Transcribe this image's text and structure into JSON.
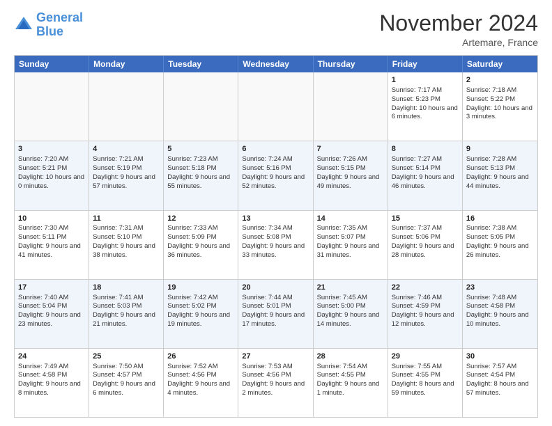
{
  "header": {
    "logo_line1": "General",
    "logo_line2": "Blue",
    "month_title": "November 2024",
    "location": "Artemare, France"
  },
  "days_of_week": [
    "Sunday",
    "Monday",
    "Tuesday",
    "Wednesday",
    "Thursday",
    "Friday",
    "Saturday"
  ],
  "weeks": [
    [
      {
        "day": "",
        "empty": true
      },
      {
        "day": "",
        "empty": true
      },
      {
        "day": "",
        "empty": true
      },
      {
        "day": "",
        "empty": true
      },
      {
        "day": "",
        "empty": true
      },
      {
        "day": "1",
        "sunrise": "Sunrise: 7:17 AM",
        "sunset": "Sunset: 5:23 PM",
        "daylight": "Daylight: 10 hours and 6 minutes."
      },
      {
        "day": "2",
        "sunrise": "Sunrise: 7:18 AM",
        "sunset": "Sunset: 5:22 PM",
        "daylight": "Daylight: 10 hours and 3 minutes."
      }
    ],
    [
      {
        "day": "3",
        "sunrise": "Sunrise: 7:20 AM",
        "sunset": "Sunset: 5:21 PM",
        "daylight": "Daylight: 10 hours and 0 minutes."
      },
      {
        "day": "4",
        "sunrise": "Sunrise: 7:21 AM",
        "sunset": "Sunset: 5:19 PM",
        "daylight": "Daylight: 9 hours and 57 minutes."
      },
      {
        "day": "5",
        "sunrise": "Sunrise: 7:23 AM",
        "sunset": "Sunset: 5:18 PM",
        "daylight": "Daylight: 9 hours and 55 minutes."
      },
      {
        "day": "6",
        "sunrise": "Sunrise: 7:24 AM",
        "sunset": "Sunset: 5:16 PM",
        "daylight": "Daylight: 9 hours and 52 minutes."
      },
      {
        "day": "7",
        "sunrise": "Sunrise: 7:26 AM",
        "sunset": "Sunset: 5:15 PM",
        "daylight": "Daylight: 9 hours and 49 minutes."
      },
      {
        "day": "8",
        "sunrise": "Sunrise: 7:27 AM",
        "sunset": "Sunset: 5:14 PM",
        "daylight": "Daylight: 9 hours and 46 minutes."
      },
      {
        "day": "9",
        "sunrise": "Sunrise: 7:28 AM",
        "sunset": "Sunset: 5:13 PM",
        "daylight": "Daylight: 9 hours and 44 minutes."
      }
    ],
    [
      {
        "day": "10",
        "sunrise": "Sunrise: 7:30 AM",
        "sunset": "Sunset: 5:11 PM",
        "daylight": "Daylight: 9 hours and 41 minutes."
      },
      {
        "day": "11",
        "sunrise": "Sunrise: 7:31 AM",
        "sunset": "Sunset: 5:10 PM",
        "daylight": "Daylight: 9 hours and 38 minutes."
      },
      {
        "day": "12",
        "sunrise": "Sunrise: 7:33 AM",
        "sunset": "Sunset: 5:09 PM",
        "daylight": "Daylight: 9 hours and 36 minutes."
      },
      {
        "day": "13",
        "sunrise": "Sunrise: 7:34 AM",
        "sunset": "Sunset: 5:08 PM",
        "daylight": "Daylight: 9 hours and 33 minutes."
      },
      {
        "day": "14",
        "sunrise": "Sunrise: 7:35 AM",
        "sunset": "Sunset: 5:07 PM",
        "daylight": "Daylight: 9 hours and 31 minutes."
      },
      {
        "day": "15",
        "sunrise": "Sunrise: 7:37 AM",
        "sunset": "Sunset: 5:06 PM",
        "daylight": "Daylight: 9 hours and 28 minutes."
      },
      {
        "day": "16",
        "sunrise": "Sunrise: 7:38 AM",
        "sunset": "Sunset: 5:05 PM",
        "daylight": "Daylight: 9 hours and 26 minutes."
      }
    ],
    [
      {
        "day": "17",
        "sunrise": "Sunrise: 7:40 AM",
        "sunset": "Sunset: 5:04 PM",
        "daylight": "Daylight: 9 hours and 23 minutes."
      },
      {
        "day": "18",
        "sunrise": "Sunrise: 7:41 AM",
        "sunset": "Sunset: 5:03 PM",
        "daylight": "Daylight: 9 hours and 21 minutes."
      },
      {
        "day": "19",
        "sunrise": "Sunrise: 7:42 AM",
        "sunset": "Sunset: 5:02 PM",
        "daylight": "Daylight: 9 hours and 19 minutes."
      },
      {
        "day": "20",
        "sunrise": "Sunrise: 7:44 AM",
        "sunset": "Sunset: 5:01 PM",
        "daylight": "Daylight: 9 hours and 17 minutes."
      },
      {
        "day": "21",
        "sunrise": "Sunrise: 7:45 AM",
        "sunset": "Sunset: 5:00 PM",
        "daylight": "Daylight: 9 hours and 14 minutes."
      },
      {
        "day": "22",
        "sunrise": "Sunrise: 7:46 AM",
        "sunset": "Sunset: 4:59 PM",
        "daylight": "Daylight: 9 hours and 12 minutes."
      },
      {
        "day": "23",
        "sunrise": "Sunrise: 7:48 AM",
        "sunset": "Sunset: 4:58 PM",
        "daylight": "Daylight: 9 hours and 10 minutes."
      }
    ],
    [
      {
        "day": "24",
        "sunrise": "Sunrise: 7:49 AM",
        "sunset": "Sunset: 4:58 PM",
        "daylight": "Daylight: 9 hours and 8 minutes."
      },
      {
        "day": "25",
        "sunrise": "Sunrise: 7:50 AM",
        "sunset": "Sunset: 4:57 PM",
        "daylight": "Daylight: 9 hours and 6 minutes."
      },
      {
        "day": "26",
        "sunrise": "Sunrise: 7:52 AM",
        "sunset": "Sunset: 4:56 PM",
        "daylight": "Daylight: 9 hours and 4 minutes."
      },
      {
        "day": "27",
        "sunrise": "Sunrise: 7:53 AM",
        "sunset": "Sunset: 4:56 PM",
        "daylight": "Daylight: 9 hours and 2 minutes."
      },
      {
        "day": "28",
        "sunrise": "Sunrise: 7:54 AM",
        "sunset": "Sunset: 4:55 PM",
        "daylight": "Daylight: 9 hours and 1 minute."
      },
      {
        "day": "29",
        "sunrise": "Sunrise: 7:55 AM",
        "sunset": "Sunset: 4:55 PM",
        "daylight": "Daylight: 8 hours and 59 minutes."
      },
      {
        "day": "30",
        "sunrise": "Sunrise: 7:57 AM",
        "sunset": "Sunset: 4:54 PM",
        "daylight": "Daylight: 8 hours and 57 minutes."
      }
    ]
  ]
}
